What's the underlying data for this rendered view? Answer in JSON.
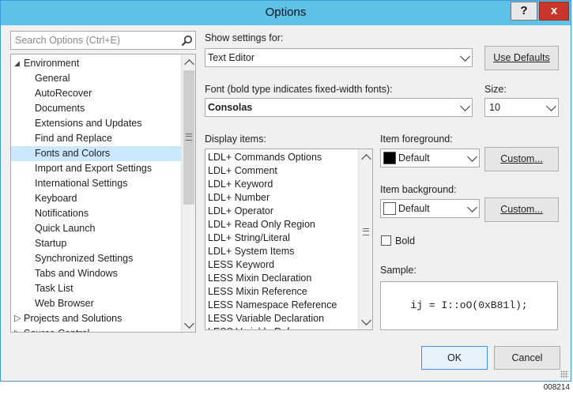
{
  "window": {
    "title": "Options",
    "help_label": "?",
    "close_label": "x"
  },
  "search": {
    "placeholder": "Search Options (Ctrl+E)"
  },
  "tree": {
    "items": [
      {
        "label": "Environment",
        "level": 0,
        "expanded": true
      },
      {
        "label": "General",
        "level": 1
      },
      {
        "label": "AutoRecover",
        "level": 1
      },
      {
        "label": "Documents",
        "level": 1
      },
      {
        "label": "Extensions and Updates",
        "level": 1
      },
      {
        "label": "Find and Replace",
        "level": 1
      },
      {
        "label": "Fonts and Colors",
        "level": 1,
        "selected": true
      },
      {
        "label": "Import and Export Settings",
        "level": 1
      },
      {
        "label": "International Settings",
        "level": 1
      },
      {
        "label": "Keyboard",
        "level": 1
      },
      {
        "label": "Notifications",
        "level": 1
      },
      {
        "label": "Quick Launch",
        "level": 1
      },
      {
        "label": "Startup",
        "level": 1
      },
      {
        "label": "Synchronized Settings",
        "level": 1
      },
      {
        "label": "Tabs and Windows",
        "level": 1
      },
      {
        "label": "Task List",
        "level": 1
      },
      {
        "label": "Web Browser",
        "level": 1
      },
      {
        "label": "Projects and Solutions",
        "level": 0,
        "expanded": false
      },
      {
        "label": "Source Control",
        "level": 0,
        "expanded": false
      }
    ]
  },
  "settings": {
    "show_for_label": "Show settings for:",
    "show_for_value": "Text Editor",
    "use_defaults_label": "Use Defaults",
    "font_label": "Font (bold type indicates fixed-width fonts):",
    "font_value": "Consolas",
    "size_label": "Size:",
    "size_value": "10"
  },
  "display_items": {
    "label": "Display items:",
    "items": [
      "LDL+ Commands Options",
      "LDL+ Comment",
      "LDL+ Keyword",
      "LDL+ Number",
      "LDL+ Operator",
      "LDL+ Read Only Region",
      "LDL+ String/Literal",
      "LDL+ System Items",
      "LESS Keyword",
      "LESS Mixin Declaration",
      "LESS Mixin Reference",
      "LESS Namespace Reference",
      "LESS Variable Declaration",
      "LESS Variable Reference"
    ]
  },
  "foreground": {
    "label": "Item foreground:",
    "value": "Default",
    "color": "#000000",
    "custom_label": "Custom..."
  },
  "background": {
    "label": "Item background:",
    "value": "Default",
    "color": "#ffffff",
    "custom_label": "Custom..."
  },
  "bold": {
    "label": "Bold",
    "checked": false
  },
  "sample": {
    "label": "Sample:",
    "text": "ij = I::oO(0xB81l);"
  },
  "footer": {
    "ok_label": "OK",
    "cancel_label": "Cancel"
  },
  "image_code": "008214",
  "colors": {
    "titlebar": "#5ec1e8",
    "close": "#c8362b",
    "selection": "#cce8ff"
  }
}
